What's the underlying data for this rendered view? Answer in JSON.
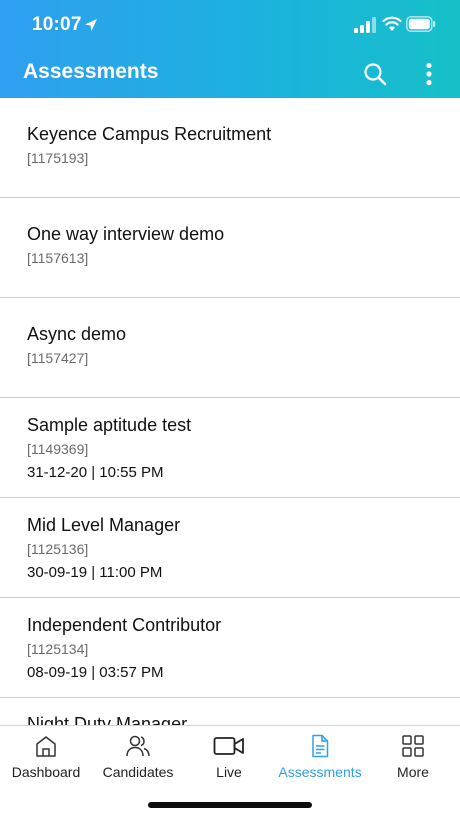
{
  "status": {
    "time": "10:07"
  },
  "header": {
    "title": "Assessments",
    "search_icon": "search-icon",
    "more_icon": "more-vertical-icon"
  },
  "assessments": [
    {
      "name": "Keyence Campus Recruitment",
      "id": "[1175193]",
      "date": ""
    },
    {
      "name": "One way interview demo",
      "id": "[1157613]",
      "date": ""
    },
    {
      "name": "Async demo",
      "id": "[1157427]",
      "date": ""
    },
    {
      "name": "Sample aptitude test",
      "id": "[1149369]",
      "date": "31-12-20 | 10:55 PM"
    },
    {
      "name": "Mid Level Manager",
      "id": "[1125136]",
      "date": "30-09-19 | 11:00 PM"
    },
    {
      "name": "Independent Contributor",
      "id": "[1125134]",
      "date": "08-09-19 | 03:57 PM"
    },
    {
      "name": "Night Duty Manager",
      "id": "",
      "date": ""
    }
  ],
  "tabs": [
    {
      "label": "Dashboard",
      "icon": "home-icon"
    },
    {
      "label": "Candidates",
      "icon": "users-icon"
    },
    {
      "label": "Live",
      "icon": "video-icon"
    },
    {
      "label": "Assessments",
      "icon": "document-icon",
      "active": true
    },
    {
      "label": "More",
      "icon": "grid-icon"
    }
  ],
  "colors": {
    "header_start": "#2f9ff0",
    "header_end": "#16c0c8",
    "active_tab": "#2e9fe8"
  }
}
